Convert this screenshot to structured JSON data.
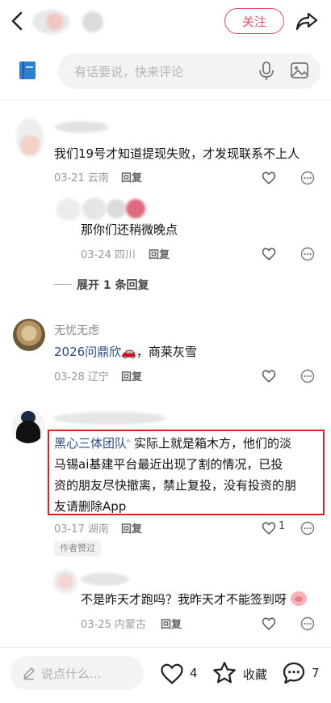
{
  "header": {
    "follow_label": "关注"
  },
  "composer": {
    "placeholder": "有话要说，快来评论"
  },
  "comments": [
    {
      "username": "",
      "text": "我们19号才知道提现失败，才发现联系不上人",
      "date": "03-21",
      "location": "云南",
      "reply_label": "回复"
    },
    {
      "username": "",
      "text": "那你们还稍微晚点",
      "date": "03-24",
      "location": "四川",
      "reply_label": "回复"
    },
    {
      "expand_label": "展开 1 条回复"
    },
    {
      "username": "无忧无虑",
      "text_link": "2026问鼎欣",
      "text_rest": "🚗，商莱灰雪",
      "date": "03-28",
      "location": "辽宁",
      "reply_label": "回复"
    },
    {
      "username": "",
      "text_link": "黑心三体团队",
      "text_rest": "实际上就是箱木方，他们的淡马锡ai基建平台最近出现了割的情况，已投资的朋友尽快撤离，禁止复投，没有投资的朋友请删除App",
      "line1_rest": "实际上就是箱木方，他们的淡",
      "line2": "马锡ai基建平台最近出现了割的情况，已投",
      "line3": "资的朋友尽快撤离，禁止复投，没有投资的朋",
      "line4": "友请删除App",
      "date": "03-17",
      "location": "湖南",
      "reply_label": "回复",
      "like_count": "1",
      "author_tag": "作者赞过"
    },
    {
      "username": "",
      "text": "不是昨天才跑吗？我昨天才不能签到呀",
      "date": "03-25",
      "location": "内蒙古",
      "reply_label": "回复"
    }
  ],
  "bottom_bar": {
    "say_placeholder": "说点什么...",
    "like_count": "4",
    "collect_label": "收藏",
    "comment_count": "7"
  },
  "colors": {
    "accent": "#e0506a",
    "link": "#2b4a8a",
    "highlight_border": "#e02020"
  },
  "icons": [
    "back-arrow-icon",
    "share-icon",
    "book-icon",
    "mic-icon",
    "image-icon",
    "heart-icon",
    "more-dots-icon",
    "pen-icon",
    "star-icon",
    "comment-bubble-icon"
  ]
}
